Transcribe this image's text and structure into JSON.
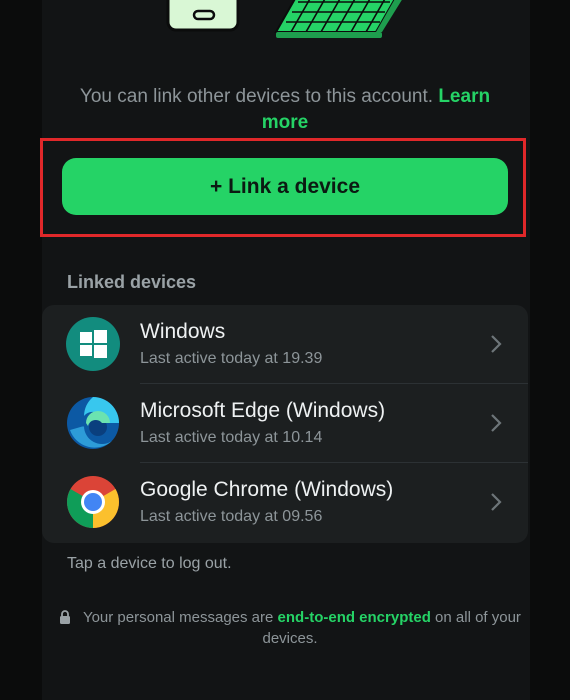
{
  "intro": {
    "text": "You can link other devices to this account.",
    "learn_more": "Learn more"
  },
  "link_button": {
    "label": "+ Link a device"
  },
  "linked_devices": {
    "title": "Linked devices",
    "items": [
      {
        "name": "Windows",
        "status": "Last active today at 19.39",
        "icon": "windows-icon"
      },
      {
        "name": "Microsoft Edge (Windows)",
        "status": "Last active today at 10.14",
        "icon": "edge-icon"
      },
      {
        "name": "Google Chrome (Windows)",
        "status": "Last active today at 09.56",
        "icon": "chrome-icon"
      }
    ]
  },
  "hint": "Tap a device to log out.",
  "footer": {
    "prefix": "Your personal messages are",
    "highlight": "end-to-end encrypted",
    "suffix": "on all of your devices."
  },
  "colors": {
    "accent": "#25d366",
    "highlight_border": "#e0282a",
    "background": "#121415"
  }
}
